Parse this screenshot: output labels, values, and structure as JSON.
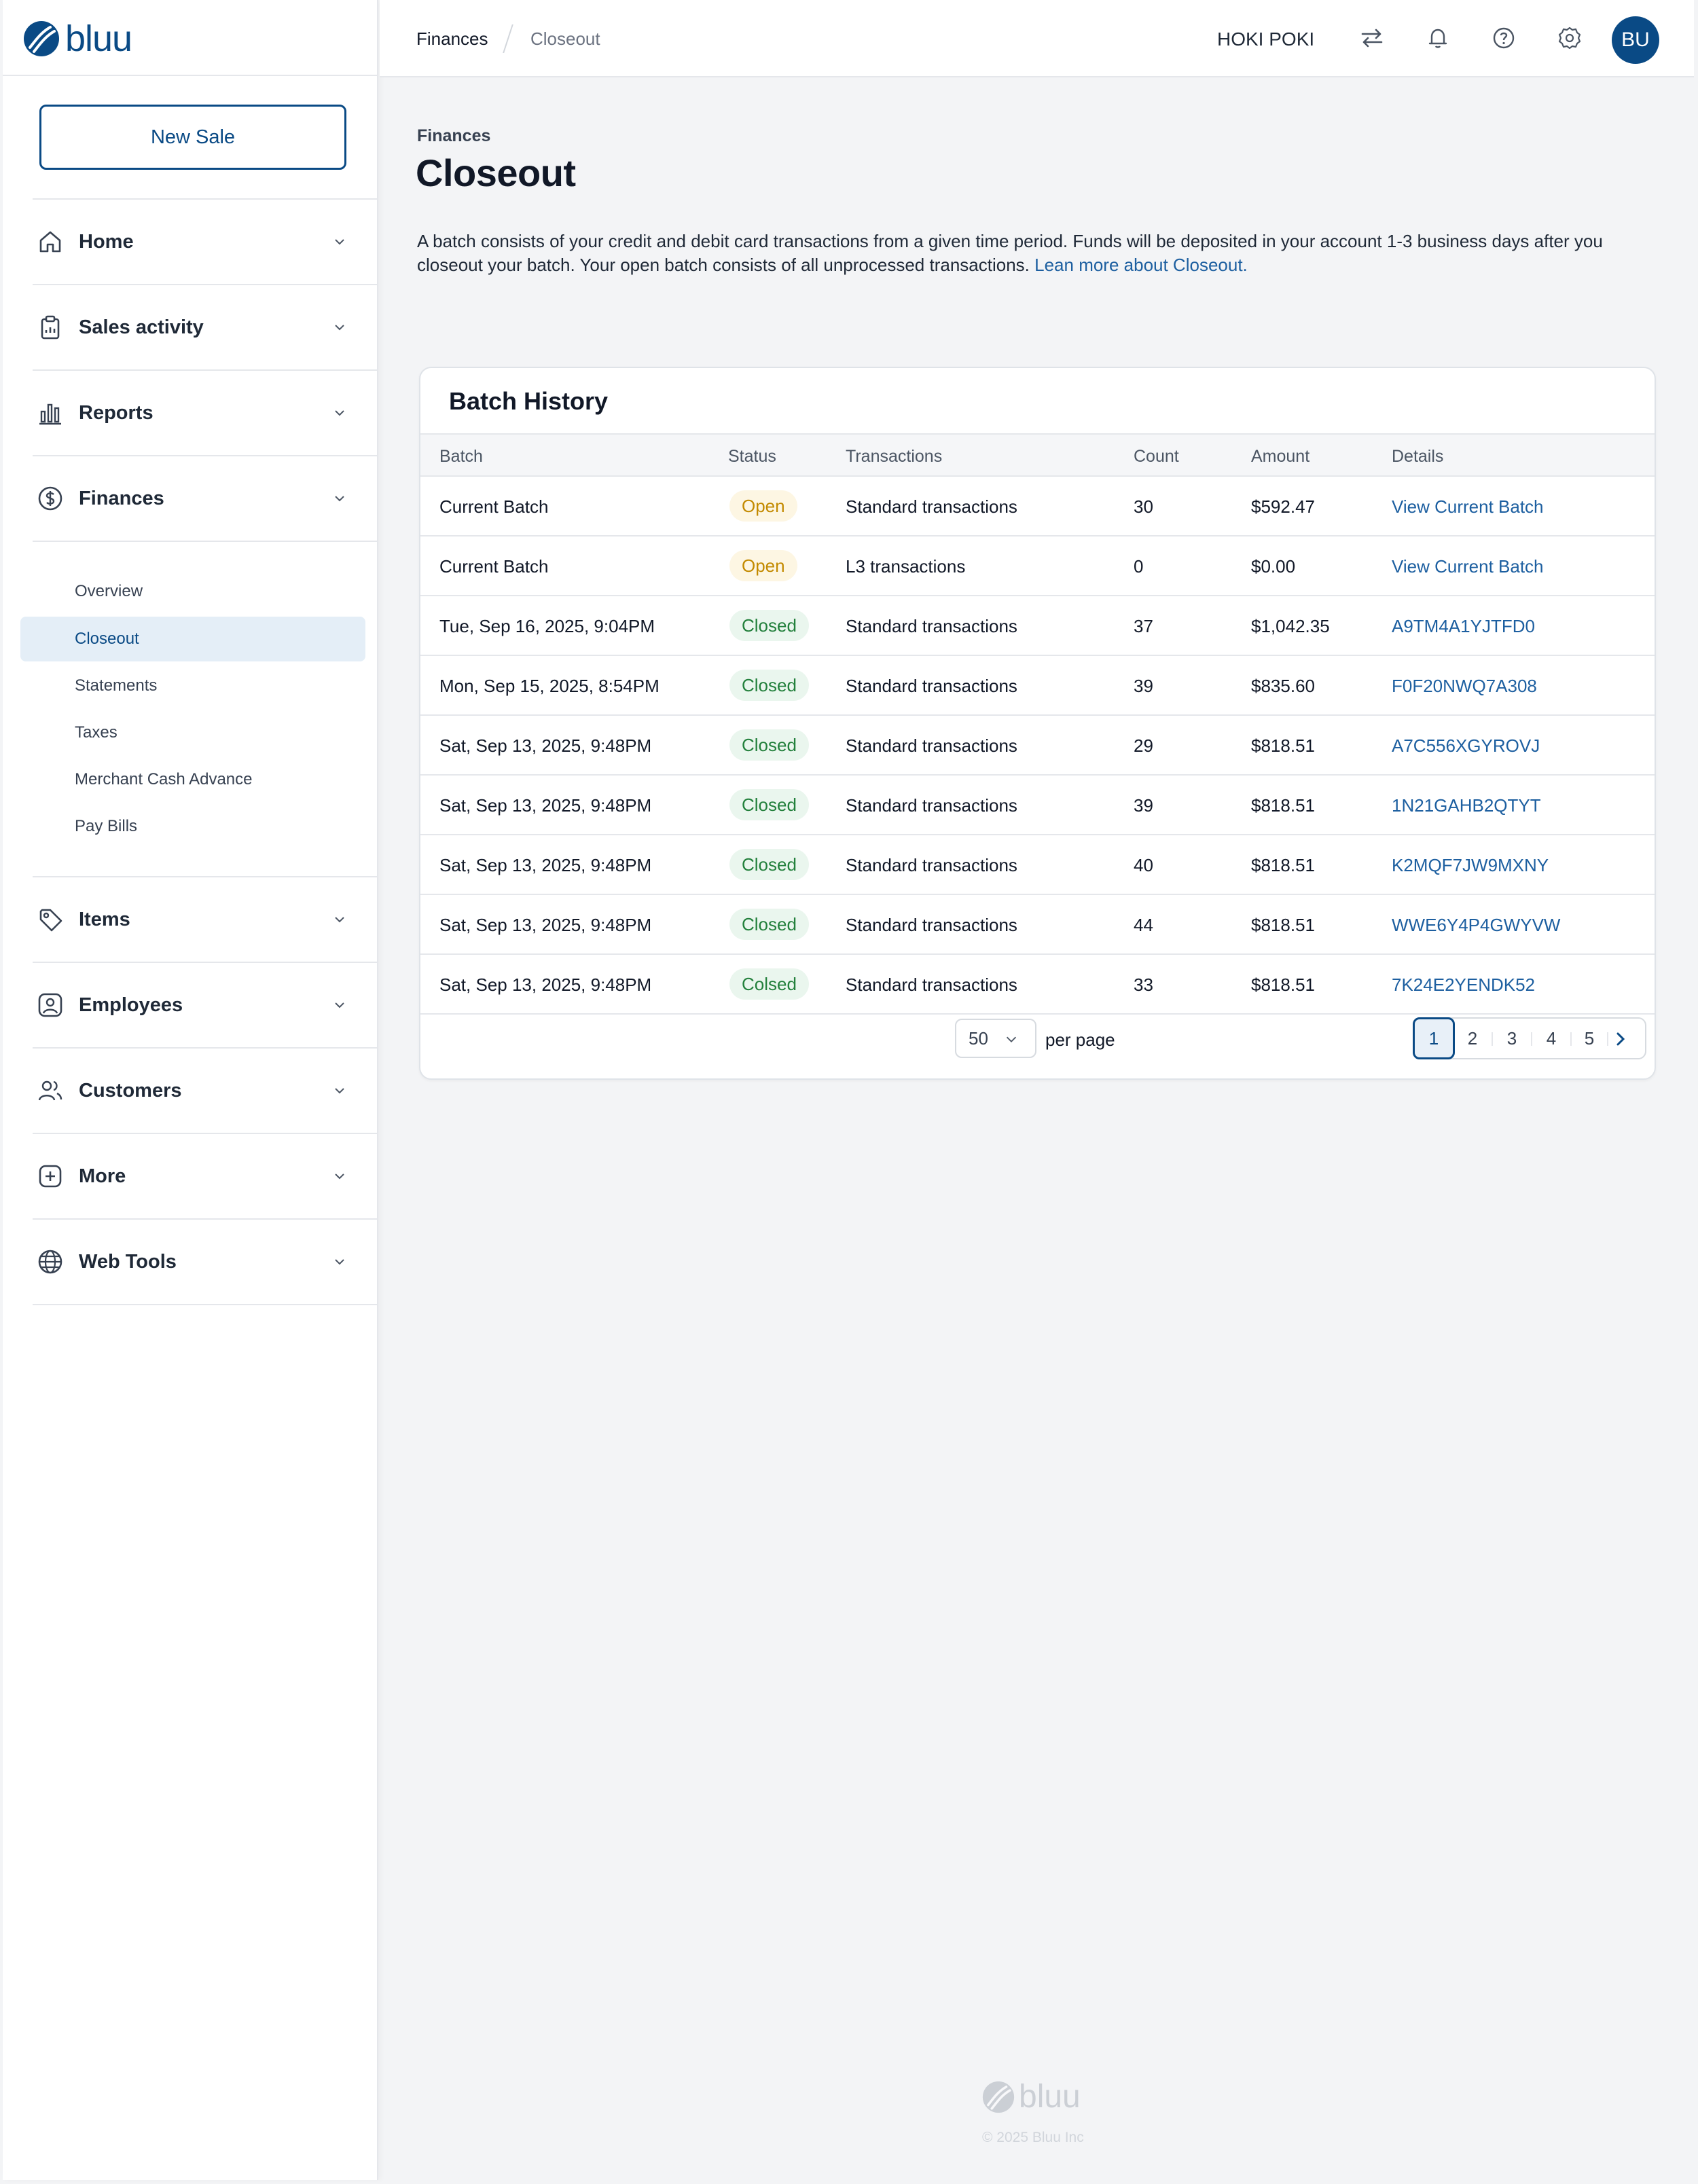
{
  "brand": {
    "name": "bluu",
    "color": "#0a4a85"
  },
  "sidebar": {
    "new_sale": "New Sale",
    "items": [
      {
        "label": "Home",
        "icon": "home-icon"
      },
      {
        "label": "Sales activity",
        "icon": "clipboard-icon"
      },
      {
        "label": "Reports",
        "icon": "bar-chart-icon"
      },
      {
        "label": "Finances",
        "icon": "dollar-circle-icon"
      },
      {
        "label": "Items",
        "icon": "tag-icon"
      },
      {
        "label": "Employees",
        "icon": "employee-badge-icon"
      },
      {
        "label": "Customers",
        "icon": "users-icon"
      },
      {
        "label": "More",
        "icon": "plus-square-icon"
      },
      {
        "label": "Web Tools",
        "icon": "globe-icon"
      }
    ],
    "finances_sub": [
      {
        "label": "Overview"
      },
      {
        "label": "Closeout",
        "active": true
      },
      {
        "label": "Statements"
      },
      {
        "label": "Taxes"
      },
      {
        "label": "Merchant Cash Advance"
      },
      {
        "label": "Pay Bills"
      }
    ]
  },
  "topbar": {
    "breadcrumb": [
      "Finances",
      "Closeout"
    ],
    "merchant": "HOKI POKI",
    "icons": [
      "switch-arrows-icon",
      "bell-icon",
      "help-icon",
      "settings-gear-icon"
    ],
    "avatar": "BU"
  },
  "page": {
    "eyebrow": "Finances",
    "title": "Closeout",
    "description": "A batch consists of your credit and debit card transactions from a given time period. Funds will be deposited in your account 1-3 business days after you closeout your batch. Your open batch consists of all unprocessed transactions.",
    "learn_more": "Lean more about Closeout."
  },
  "batch_history": {
    "title": "Batch History",
    "columns": [
      "Batch",
      "Status",
      "Transactions",
      "Count",
      "Amount",
      "Details"
    ],
    "rows": [
      {
        "batch": "Current Batch",
        "status": "Open",
        "transactions": "Standard transactions",
        "count": "30",
        "amount": "$592.47",
        "details": "View Current Batch"
      },
      {
        "batch": "Current Batch",
        "status": "Open",
        "transactions": "L3 transactions",
        "count": "0",
        "amount": "$0.00",
        "details": "View Current Batch"
      },
      {
        "batch": "Tue, Sep 16, 2025, 9:04PM",
        "status": "Closed",
        "transactions": "Standard transactions",
        "count": "37",
        "amount": "$1,042.35",
        "details": "A9TM4A1YJTFD0"
      },
      {
        "batch": "Mon, Sep 15, 2025, 8:54PM",
        "status": "Closed",
        "transactions": "Standard transactions",
        "count": "39",
        "amount": "$835.60",
        "details": "F0F20NWQ7A308"
      },
      {
        "batch": "Sat, Sep 13, 2025, 9:48PM",
        "status": "Closed",
        "transactions": "Standard transactions",
        "count": "29",
        "amount": "$818.51",
        "details": "A7C556XGYROVJ"
      },
      {
        "batch": "Sat, Sep 13, 2025, 9:48PM",
        "status": "Closed",
        "transactions": "Standard transactions",
        "count": "39",
        "amount": "$818.51",
        "details": "1N21GAHB2QTYT"
      },
      {
        "batch": "Sat, Sep 13, 2025, 9:48PM",
        "status": "Closed",
        "transactions": "Standard transactions",
        "count": "40",
        "amount": "$818.51",
        "details": "K2MQF7JW9MXNY"
      },
      {
        "batch": "Sat, Sep 13, 2025, 9:48PM",
        "status": "Closed",
        "transactions": "Standard transactions",
        "count": "44",
        "amount": "$818.51",
        "details": "WWE6Y4P4GWYVW"
      },
      {
        "batch": "Sat, Sep 13, 2025, 9:48PM",
        "status": "Colsed",
        "transactions": "Standard transactions",
        "count": "33",
        "amount": "$818.51",
        "details": "7K24E2YENDK52"
      }
    ],
    "per_page_value": "50",
    "per_page_label": "per page",
    "pages": [
      "1",
      "2",
      "3",
      "4",
      "5"
    ],
    "current_page": "1"
  },
  "footer": {
    "brand": "bluu",
    "copyright": "© 2025 Bluu Inc"
  },
  "colors": {
    "accent": "#0a4a85",
    "link": "#1d5fa0",
    "open_badge": "#c38a00",
    "closed_badge": "#23803c"
  }
}
